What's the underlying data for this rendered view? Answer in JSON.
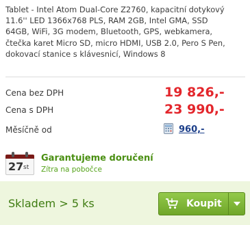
{
  "product": {
    "description": "Tablet - Intel Atom Dual-Core Z2760, kapacitní dotykový\n11.6'' LED 1366x768 PLS, RAM 2GB, Intel GMA, SSD\n64GB, WiFi, 3G modem, Bluetooth, GPS, webkamera,\nčtečka karet Micro SD, micro HDMI, USB 2.0, Pero S Pen,\ndokovací stanice s klávesnicí, Windows 8"
  },
  "prices": {
    "without_vat_label": "Cena bez DPH",
    "without_vat_value": "19 826,-",
    "with_vat_label": "Cena s DPH",
    "with_vat_value": "23 990,-",
    "monthly_label": "Měsíčně od",
    "monthly_value": "960,-",
    "monthly_icon": "calculator-icon"
  },
  "delivery": {
    "calendar_day": "27",
    "calendar_suffix": "st",
    "title": "Garantujeme doručení",
    "subtitle": "Zítra na pobočce",
    "icon": "calendar-icon"
  },
  "stock": {
    "status": "Skladem > 5 ks"
  },
  "buy": {
    "label": "Koupit",
    "icon": "cart-icon",
    "dropdown_icon": "chevron-down-icon"
  },
  "colors": {
    "price_red": "#e3262c",
    "green_accent": "#4a8f12",
    "button_green": "#7fb63a",
    "stock_bg": "#eef6de",
    "link_blue": "#1c3f8a"
  }
}
